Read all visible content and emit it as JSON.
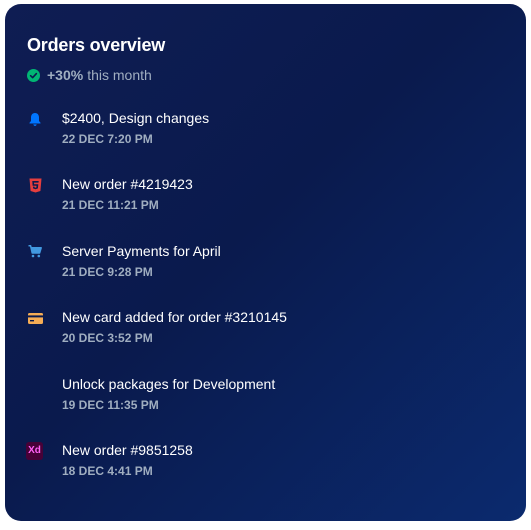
{
  "header": {
    "title": "Orders overview",
    "percent": "+30%",
    "period": "this month"
  },
  "colors": {
    "accent_green": "#01b574",
    "bell_blue": "#0075ff",
    "html5_red": "#e53e3e",
    "cart_blue": "#4299e1",
    "card_orange": "#f6ad55",
    "xd_pink": "#ff61f6"
  },
  "items": [
    {
      "icon": "bell-icon",
      "title": "$2400, Design changes",
      "date": "22 DEC 7:20 PM"
    },
    {
      "icon": "html5-icon",
      "title": "New order #4219423",
      "date": "21 DEC 11:21 PM"
    },
    {
      "icon": "cart-icon",
      "title": "Server Payments for April",
      "date": "21 DEC 9:28 PM"
    },
    {
      "icon": "credit-card-icon",
      "title": "New card added for order #3210145",
      "date": "20 DEC 3:52 PM"
    },
    {
      "icon": "",
      "title": "Unlock packages for Development",
      "date": "19 DEC 11:35 PM"
    },
    {
      "icon": "adobe-xd-icon",
      "title": "New order #9851258",
      "date": "18 DEC 4:41 PM",
      "icon_text": "Xd"
    }
  ]
}
